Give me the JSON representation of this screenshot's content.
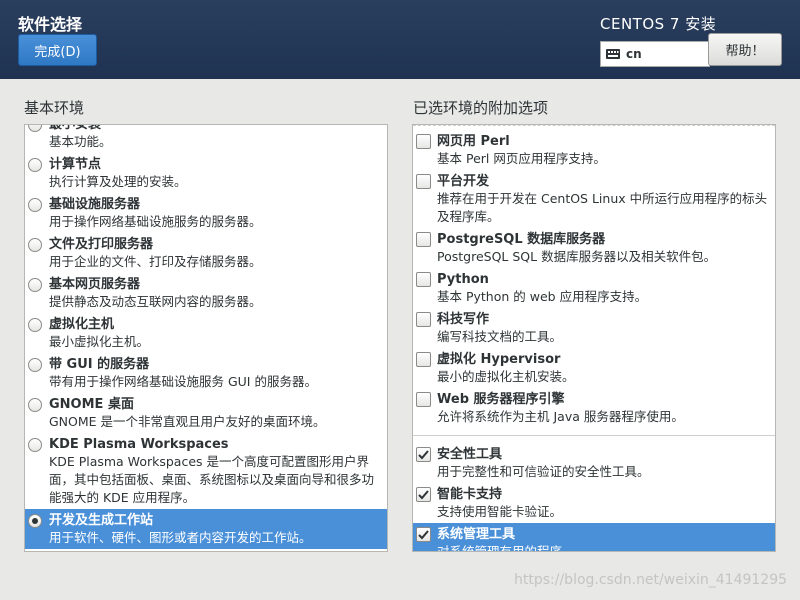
{
  "header": {
    "page_title": "软件选择",
    "done_label": "完成(D)",
    "product_title": "CENTOS 7 安装",
    "keyboard_layout": "cn",
    "help_label": "帮助！"
  },
  "base_env": {
    "heading": "基本环境",
    "items": [
      {
        "name": "最小安装",
        "desc": "基本功能。",
        "selected": false
      },
      {
        "name": "计算节点",
        "desc": "执行计算及处理的安装。",
        "selected": false
      },
      {
        "name": "基础设施服务器",
        "desc": "用于操作网络基础设施服务的服务器。",
        "selected": false
      },
      {
        "name": "文件及打印服务器",
        "desc": "用于企业的文件、打印及存储服务器。",
        "selected": false
      },
      {
        "name": "基本网页服务器",
        "desc": "提供静态及动态互联网内容的服务器。",
        "selected": false
      },
      {
        "name": "虚拟化主机",
        "desc": "最小虚拟化主机。",
        "selected": false
      },
      {
        "name": "带 GUI 的服务器",
        "desc": "带有用于操作网络基础设施服务 GUI 的服务器。",
        "selected": false
      },
      {
        "name": "GNOME 桌面",
        "desc": "GNOME 是一个非常直观且用户友好的桌面环境。",
        "selected": false
      },
      {
        "name": "KDE Plasma Workspaces",
        "desc": "KDE Plasma Workspaces 是一个高度可配置图形用户界面，其中包括面板、桌面、系统图标以及桌面向导和很多功能强大的 KDE 应用程序。",
        "selected": false
      },
      {
        "name": "开发及生成工作站",
        "desc": "用于软件、硬件、图形或者内容开发的工作站。",
        "selected": true
      }
    ]
  },
  "addons": {
    "heading": "已选环境的附加选项",
    "items": [
      {
        "name": "网页用 Perl",
        "desc": "基本 Perl 网页应用程序支持。",
        "checked": false
      },
      {
        "name": "平台开发",
        "desc": "推荐在用于开发在 CentOS Linux 中所运行应用程序的标头及程序库。",
        "checked": false
      },
      {
        "name": "PostgreSQL 数据库服务器",
        "desc": "PostgreSQL SQL 数据库服务器以及相关软件包。",
        "checked": false
      },
      {
        "name": "Python",
        "desc": "基本 Python 的 web 应用程序支持。",
        "checked": false
      },
      {
        "name": "科技写作",
        "desc": "编写科技文档的工具。",
        "checked": false
      },
      {
        "name": "虚拟化 Hypervisor",
        "desc": "最小的虚拟化主机安装。",
        "checked": false
      },
      {
        "name": "Web 服务器程序引擎",
        "desc": "允许将系统作为主机 Java 服务器程序使用。",
        "checked": false
      },
      {
        "name": "安全性工具",
        "desc": "用于完整性和可信验证的安全性工具。",
        "checked": true
      },
      {
        "name": "智能卡支持",
        "desc": "支持使用智能卡验证。",
        "checked": true
      },
      {
        "name": "系统管理工具",
        "desc": "对系统管理有用的程序。",
        "checked": true,
        "selected": true
      }
    ]
  },
  "watermark": "https://blog.csdn.net/weixin_41491295",
  "colors": {
    "header_bg": "#1f3252",
    "accent": "#4a90d9"
  }
}
